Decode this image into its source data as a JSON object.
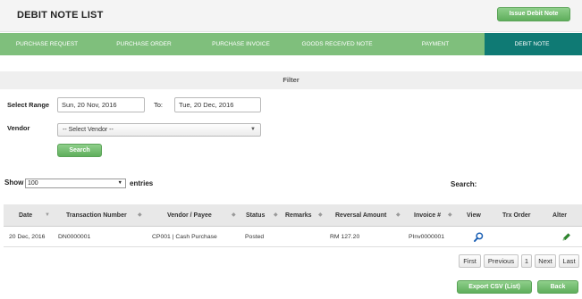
{
  "header": {
    "title": "DEBIT NOTE LIST",
    "issue_button": "Issue Debit Note"
  },
  "nav": {
    "items": [
      {
        "label": "PURCHASE REQUEST"
      },
      {
        "label": "PURCHASE ORDER"
      },
      {
        "label": "PURCHASE INVOICE"
      },
      {
        "label": "GOODS RECEIVED NOTE"
      },
      {
        "label": "PAYMENT"
      },
      {
        "label": "DEBIT NOTE"
      }
    ],
    "active": "DEBIT NOTE"
  },
  "filter": {
    "heading": "Filter",
    "range_label": "Select Range",
    "from_value": "Sun, 20 Nov, 2016",
    "to_label": "To:",
    "to_value": "Tue, 20 Dec, 2016",
    "vendor_label": "Vendor",
    "vendor_selected": "-- Select Vendor --",
    "search_button": "Search"
  },
  "list_controls": {
    "show_label": "Show",
    "entries_value": "100",
    "entries_label": "entries",
    "search_label": "Search:"
  },
  "table": {
    "columns": [
      "Date",
      "Transaction Number",
      "Vendor / Payee",
      "Status",
      "Remarks",
      "Reversal Amount",
      "Invoice #",
      "View",
      "Trx Order",
      "Alter"
    ],
    "rows": [
      {
        "date": "20 Dec, 2016",
        "transaction_number": "DN0000001",
        "vendor": "CP001 | Cash Purchase",
        "status": "Posted",
        "remarks": "",
        "reversal_amount": "RM 127.20",
        "invoice": "PInv0000001",
        "trx_order": ""
      }
    ]
  },
  "pagination": {
    "first": "First",
    "previous": "Previous",
    "page": "1",
    "next": "Next",
    "last": "Last"
  },
  "footer": {
    "export_button": "Export CSV (List)",
    "back_button": "Back"
  },
  "icons": {
    "view": "magnifier-icon",
    "alter": "pencil-icon"
  },
  "colors": {
    "nav_bg": "#7fbf7c",
    "nav_active": "#0f7a74",
    "button_green": "#5fae5c",
    "icon_blue": "#1a5fb4",
    "icon_green": "#2e8b2e"
  }
}
